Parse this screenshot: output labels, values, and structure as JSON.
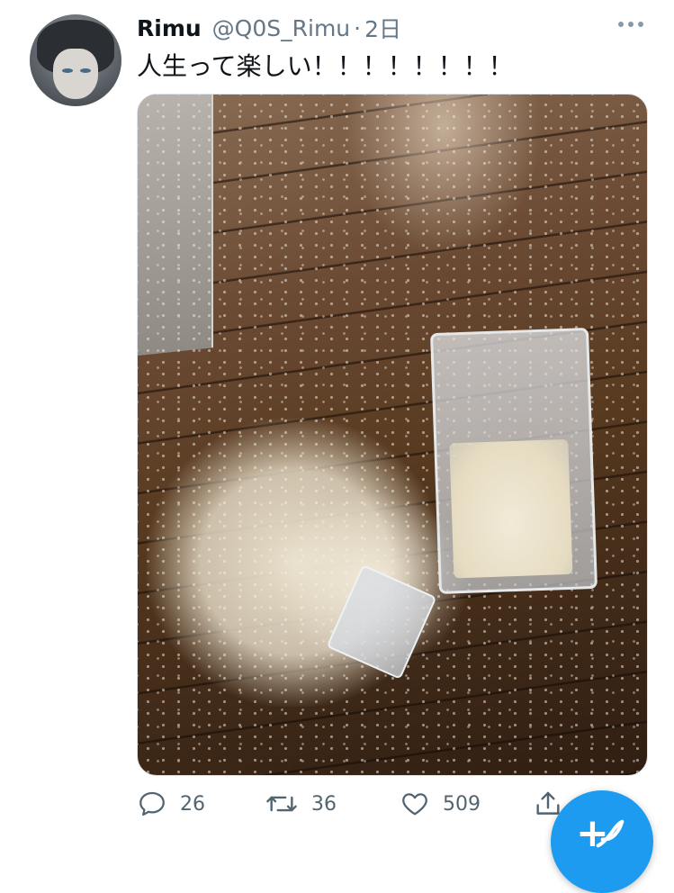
{
  "tweet": {
    "display_name": "Rimu",
    "handle": "@Q0S_Rimu",
    "separator": "·",
    "time": "2日",
    "text": "人生って楽しい！！！！！！！！"
  },
  "media": {
    "description_icon": "photo"
  },
  "actions": {
    "reply_count": "26",
    "retweet_count": "36",
    "like_count": "509"
  },
  "compose": {
    "glyph": "+"
  },
  "colors": {
    "accent": "#1d9bf0",
    "secondary_text": "#657786",
    "icon_gray": "#536471"
  }
}
